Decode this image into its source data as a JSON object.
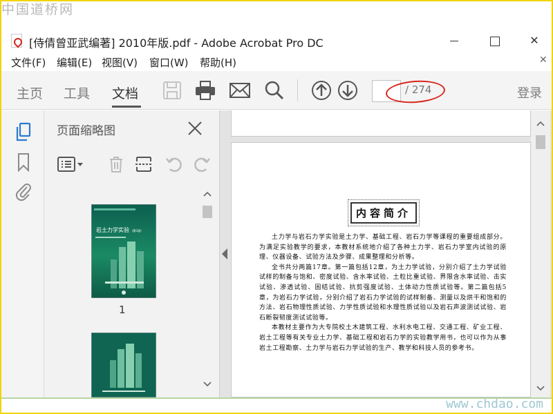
{
  "watermark": {
    "top": "中国道桥网",
    "bottom": "www.chdao.com"
  },
  "window": {
    "title": "[侍倩曾亚武编著] 2010年版.pdf - Adobe Acrobat Pro DC",
    "minimize_icon": "minimize-icon",
    "maximize_icon": "maximize-icon",
    "close_label": "✕"
  },
  "menu": {
    "items": [
      {
        "label": "文件(F)"
      },
      {
        "label": "编辑(E)"
      },
      {
        "label": "视图(V)"
      },
      {
        "label": "窗口(W)"
      },
      {
        "label": "帮助(H)"
      }
    ],
    "close_label": "✕"
  },
  "toolbar": {
    "tabs": [
      {
        "label": "主页",
        "active": false
      },
      {
        "label": "工具",
        "active": false
      },
      {
        "label": "文档",
        "active": true
      }
    ],
    "icons": [
      "save-icon",
      "print-icon",
      "email-icon",
      "search-icon",
      "prev-page-icon",
      "next-page-icon"
    ],
    "page_current": "",
    "page_total": "/ 274",
    "login_label": "登录",
    "highlight_color": "#d8251c"
  },
  "navrail": {
    "icons": [
      "pages-icon",
      "bookmark-icon",
      "attachment-icon"
    ],
    "active_color": "#2a7ad2"
  },
  "thumbnails_pane": {
    "title": "页面缩略图",
    "tools": [
      "options-icon",
      "delete-icon",
      "insert-icon",
      "rotate-left-icon",
      "rotate-right-icon"
    ],
    "thumbs": [
      {
        "page": "1",
        "cover_title": "岩土力学实验",
        "cover_edition": "(第2版)"
      },
      {
        "page": ""
      }
    ]
  },
  "document": {
    "heading": "内容简介",
    "paragraphs": [
      "土力学与岩石力学实验是土力学、基础工程、岩石力学等课程的重要组成部分。为满足实验教学的要求，本教材系统地介绍了各种土力学、岩石力学室内试验的原理、仪器设备、试验方法及步骤、成果整理和分析等。",
      "全书共分两篇17章。第一篇包括12章，为土力学试验，分别介绍了土力学试验试样的制备与饱和、密度试验、含水率试验、土粒比重试验、界限含水率试验、击实试验、渗透试验、固结试验、抗剪强度试验、土体动力性质试验等。第二篇包括5章，为岩石力学试验，分别介绍了岩石力学试验的试样制备、测量以及烘干和饱和的方法、岩石物理性质试验、力学性质试验和水理性质试验以及岩石声波测试试验、岩石断裂韧度测试试验等。",
      "本教材主要作为大专院校土木建筑工程、水利水电工程、交通工程、矿业工程、岩土工程等有关专业土力学、基础工程和岩石力学的实验教学用书，也可以作为从事岩土工程勘察、土力学与岩石力学试验的生产、教学和科技人员的参考书。"
    ]
  }
}
